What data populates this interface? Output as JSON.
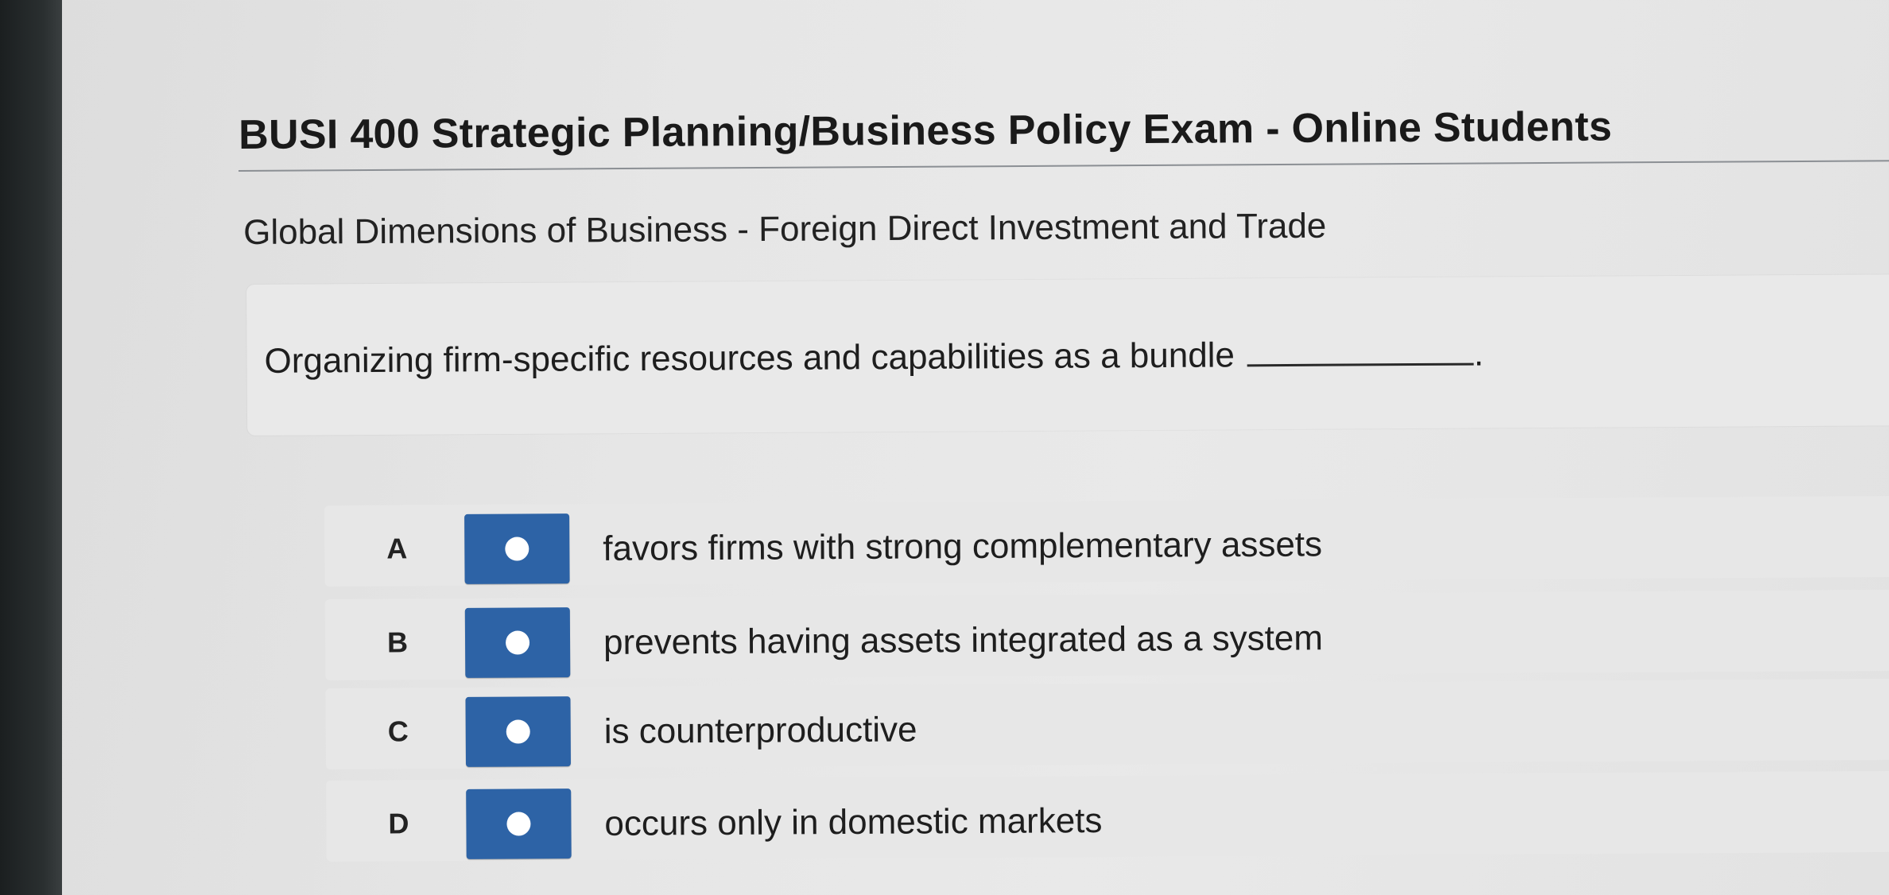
{
  "header": {
    "exam_title": "BUSI 400 Strategic Planning/Business Policy Exam - Online Students",
    "topic": "Global Dimensions of Business - Foreign Direct Investment and Trade"
  },
  "question": {
    "text": "Organizing firm-specific resources and capabilities as a bundle",
    "trailing_punctuation": "."
  },
  "options": [
    {
      "letter": "A",
      "text": "favors firms with strong complementary assets",
      "selected": false
    },
    {
      "letter": "B",
      "text": "prevents having assets integrated as a system",
      "selected": false
    },
    {
      "letter": "C",
      "text": "is counterproductive",
      "selected": false
    },
    {
      "letter": "D",
      "text": "occurs only in domestic markets",
      "selected": false
    }
  ],
  "colors": {
    "radio_button": "#2d63a6",
    "radio_dot": "#ffffff"
  }
}
